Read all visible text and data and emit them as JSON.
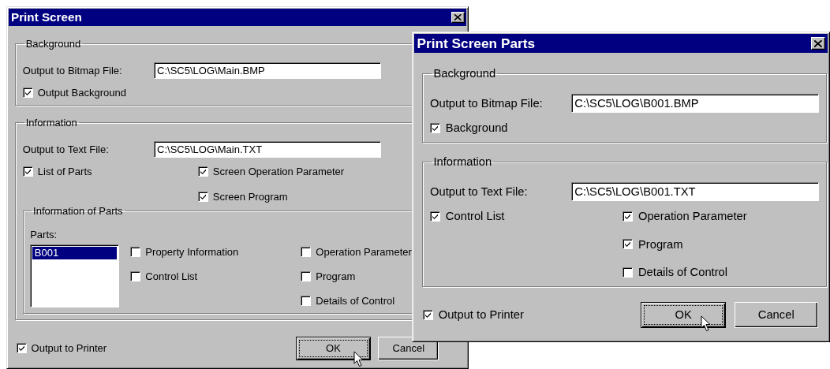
{
  "windows": [
    {
      "title": "Print Screen",
      "background": {
        "legend": "Background",
        "field_label": "Output to Bitmap File:",
        "field_value": "C:\\SC5\\LOG\\Main.BMP",
        "left_checkboxes": [
          {
            "label": "Output Background",
            "checked": true
          }
        ]
      },
      "information": {
        "legend": "Information",
        "field_label": "Output to Text File:",
        "field_value": "C:\\SC5\\LOG\\Main.TXT",
        "left_checkboxes": [
          {
            "label": "List of Parts",
            "checked": true
          }
        ],
        "right_checkboxes": [
          {
            "label": "Screen Operation Parameter",
            "checked": true
          },
          {
            "label": "Screen Program",
            "checked": true
          }
        ],
        "parts_group": {
          "legend": "Information of Parts",
          "list_label": "Parts:",
          "parts": [
            {
              "label": "B001",
              "selected": true
            }
          ],
          "left_checkboxes": [
            {
              "label": "Property Information",
              "checked": false
            },
            {
              "label": "Control List",
              "checked": false
            }
          ],
          "right_checkboxes": [
            {
              "label": "Operation Parameter",
              "checked": false
            },
            {
              "label": "Program",
              "checked": false
            },
            {
              "label": "Details of Control",
              "checked": false
            }
          ]
        }
      },
      "output_to_printer": {
        "label": "Output to Printer",
        "checked": true
      },
      "buttons": [
        {
          "label": "OK",
          "default": true
        },
        {
          "label": "Cancel",
          "default": false
        }
      ]
    },
    {
      "title": "Print Screen Parts",
      "background": {
        "legend": "Background",
        "field_label": "Output to Bitmap File:",
        "field_value": "C:\\SC5\\LOG\\B001.BMP",
        "left_checkboxes": [
          {
            "label": "Background",
            "checked": true
          }
        ]
      },
      "information": {
        "legend": "Information",
        "field_label": "Output to Text File:",
        "field_value": "C:\\SC5\\LOG\\B001.TXT",
        "left_checkboxes": [
          {
            "label": "Control List",
            "checked": true
          }
        ],
        "right_checkboxes": [
          {
            "label": "Operation Parameter",
            "checked": true
          },
          {
            "label": "Program",
            "checked": true
          },
          {
            "label": "Details of Control",
            "checked": false
          }
        ]
      },
      "output_to_printer": {
        "label": "Output to Printer",
        "checked": true
      },
      "buttons": [
        {
          "label": "OK",
          "default": true
        },
        {
          "label": "Cancel",
          "default": false
        }
      ]
    }
  ]
}
